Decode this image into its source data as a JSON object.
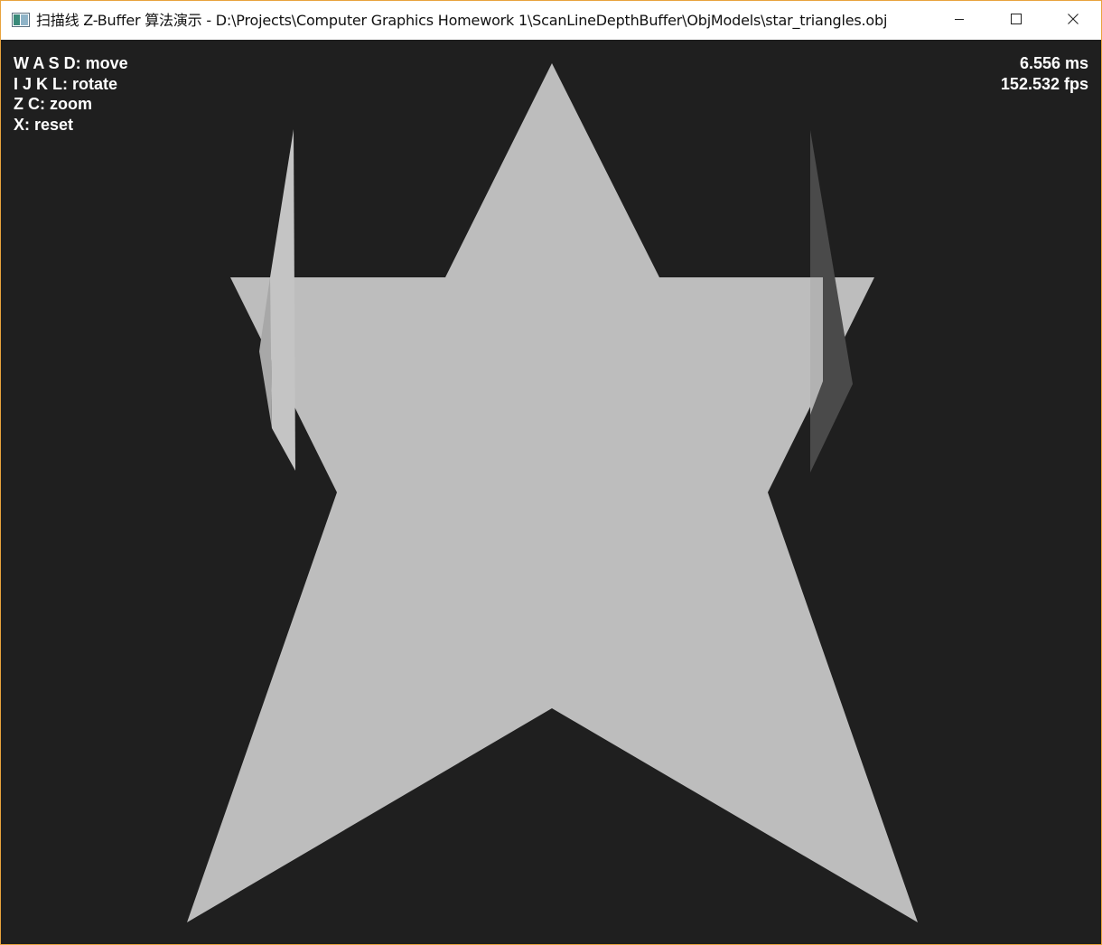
{
  "window": {
    "title": "扫描线 Z-Buffer 算法演示 - D:\\Projects\\Computer Graphics Homework 1\\ScanLineDepthBuffer\\ObjModels\\star_triangles.obj",
    "icon": "app-window-icon",
    "controls": {
      "minimize_icon": "minimize-icon",
      "maximize_icon": "maximize-icon",
      "close_icon": "close-icon"
    },
    "accent_border_color": "#e8a33d"
  },
  "viewport": {
    "background_color": "#1f1f1f",
    "help": [
      "W A S D: move",
      "I J K L: rotate",
      "Z C: zoom",
      "X: reset"
    ],
    "stats": {
      "frame_time": "6.556 ms",
      "fps": "152.532 fps"
    },
    "scene": {
      "model": "star_triangles.obj",
      "shape": "star",
      "colors": {
        "main_face": "#bdbdbd",
        "left_edge_face": "#c4c4c4",
        "right_edge_face": "#4a4a4a"
      }
    }
  }
}
